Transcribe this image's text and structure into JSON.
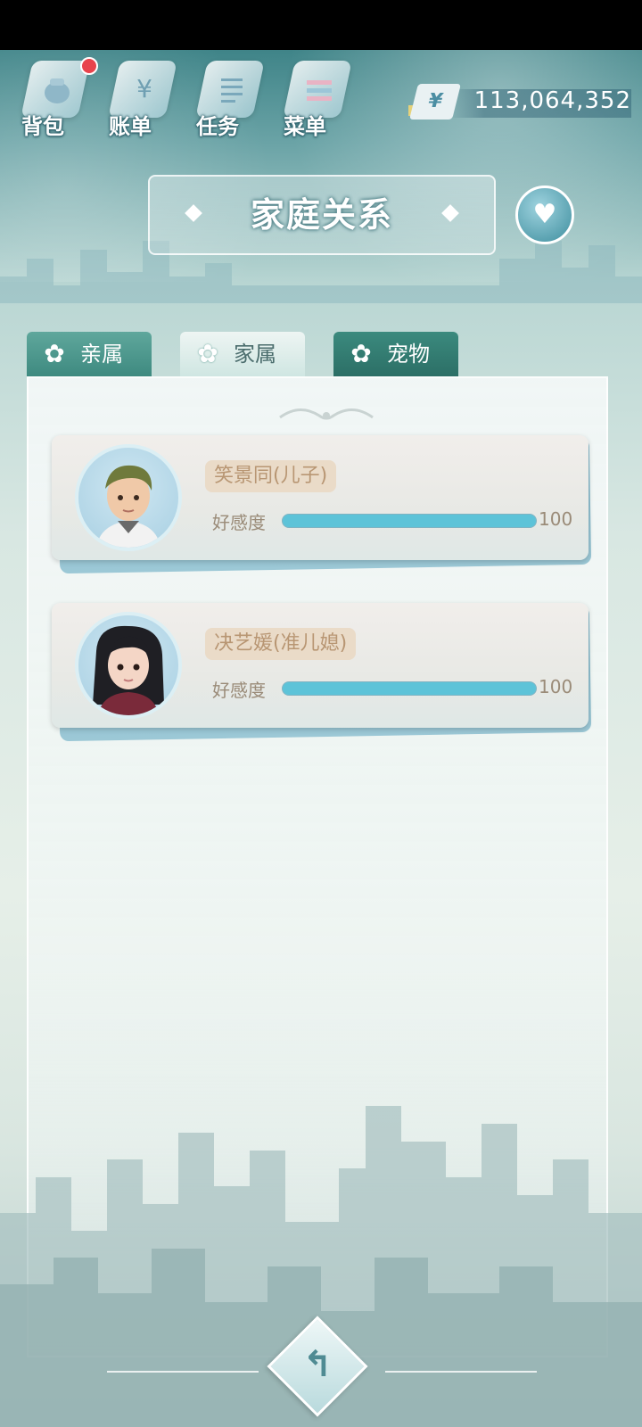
{
  "nav": {
    "items": [
      {
        "label": "背包",
        "icon": "bag-icon",
        "badge": true
      },
      {
        "label": "账单",
        "icon": "bill-icon",
        "glyph": "¥"
      },
      {
        "label": "任务",
        "icon": "task-icon"
      },
      {
        "label": "菜单",
        "icon": "menu-icon"
      }
    ]
  },
  "money": {
    "currency": "¥",
    "amount": "113,064,352"
  },
  "title": "家庭关系",
  "tabs": [
    {
      "label": "亲属",
      "active": false
    },
    {
      "label": "家属",
      "active": true
    },
    {
      "label": "宠物",
      "active": false
    }
  ],
  "members": [
    {
      "name": "笑景同(儿子)",
      "affinity_label": "好感度",
      "affinity": 100,
      "affinity_max": 100
    },
    {
      "name": "决艺媛(准儿媳)",
      "affinity_label": "好感度",
      "affinity": 100,
      "affinity_max": 100
    }
  ],
  "colors": {
    "bar_fill": "#5dc3d8",
    "badge": "#e8434c",
    "tab_active": "#cfe6e2",
    "tab_inactive": "#3e8a80"
  }
}
